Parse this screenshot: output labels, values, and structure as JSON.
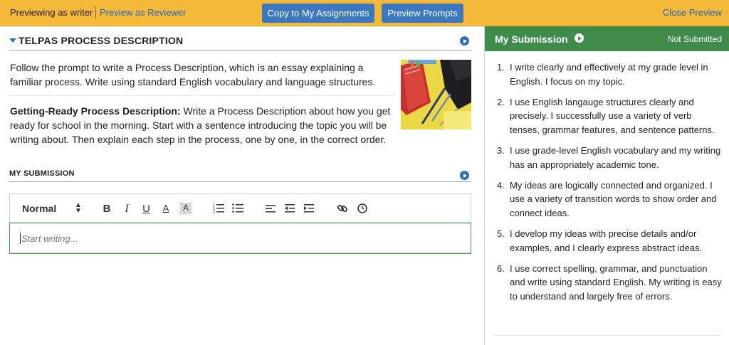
{
  "topbar": {
    "mode_label": "Previewing as writer",
    "preview_reviewer": "Preview as Reviewer",
    "copy_button": "Copy to My Assignments",
    "preview_prompts_button": "Preview Prompts",
    "close_preview": "Close Preview"
  },
  "assignment": {
    "section_title": "TELPAS PROCESS DESCRIPTION",
    "intro": "Follow the prompt to write a Process Description, which is an essay explaining a familiar process. Write using standard English vocabulary and language structures.",
    "prompt_title": "Getting-Ready Process Description:",
    "prompt_body": "Write a Process Description about how you get ready for school in the morning. Start with a sentence introducing the topic you will be writing about. Then explain each step in the process, one by one, in the correct order."
  },
  "submission": {
    "section_title": "MY SUBMISSION",
    "format_select": "Normal",
    "placeholder": "Start writing..."
  },
  "toolbar_icons": [
    "bold-icon",
    "italic-icon",
    "underline-icon",
    "font-color-icon",
    "highlight-icon",
    "ordered-list-icon",
    "bullet-list-icon",
    "align-left-icon",
    "outdent-icon",
    "indent-icon",
    "link-icon",
    "clock-icon"
  ],
  "right_panel": {
    "title": "My Submission",
    "status": "Not Submitted",
    "criteria": [
      "I write clearly and effectively at my grade level in English. I focus on my topic.",
      "I use English langauge structures clearly and precisely. I successfully use a variety of verb tenses, grammar features, and sentence patterns.",
      "I use grade-level English vocabulary and my writing has an appropriately academic tone.",
      "My ideas are logically connected and organized. I use a variety of transition words to show order and connect ideas.",
      "I develop my ideas with precise details and/or examples, and I clearly express abstract ideas.",
      "I use correct spelling, grammar, and punctuation and write using standard English. My writing is easy to understand and largely free of errors."
    ]
  },
  "colors": {
    "topbar": "#f5b93a",
    "button": "#3a78c2",
    "link": "#1f67b8",
    "panel_header": "#3e8b4b",
    "editor_border": "#4c9a57"
  }
}
